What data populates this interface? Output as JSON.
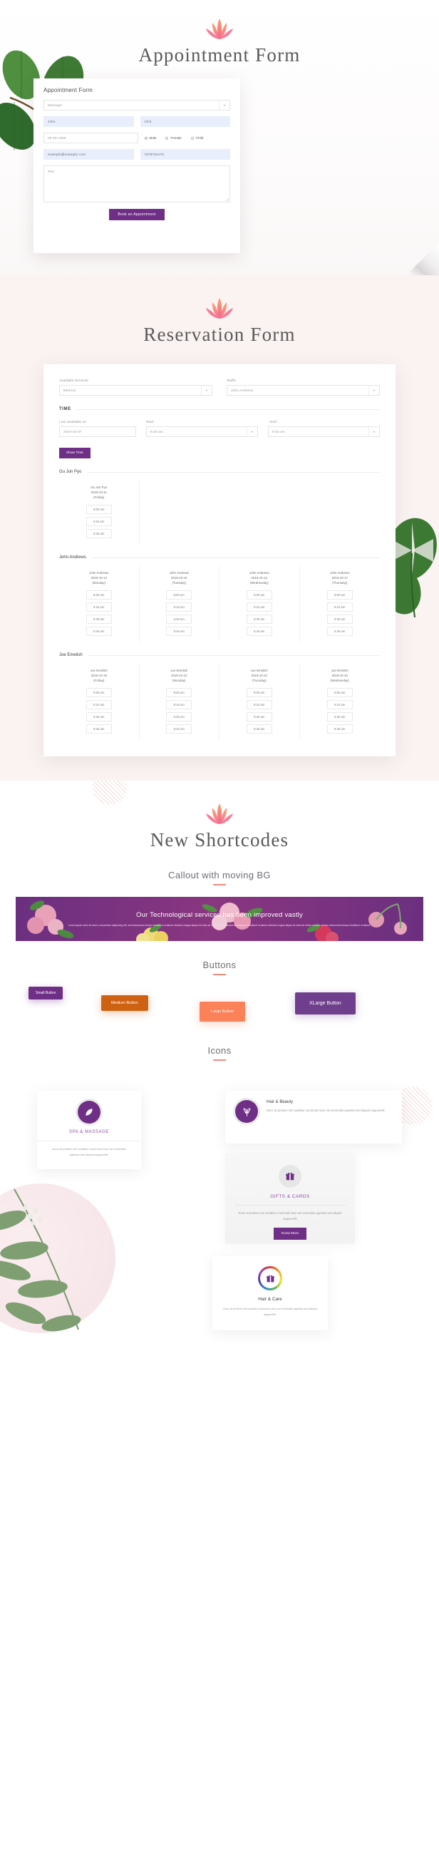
{
  "appointment": {
    "page_title": "Appointment Form",
    "card_title": "Appointment Form",
    "service_value": "Massage",
    "first_name": "John",
    "last_name": "Clint",
    "dob": "08-09-1996",
    "gender_options": [
      "Male",
      "Female",
      "Child"
    ],
    "gender_selected": "Male",
    "email": "example@example.com",
    "phone": "7878754175",
    "message": "Test",
    "submit_label": "Book an Appointment"
  },
  "reservation": {
    "page_title": "Reservation Form",
    "services_label": "Available Services",
    "services_value": "Medical",
    "staffs_label": "Staffs",
    "staffs_value": "John Andrews",
    "time_heading": "TIME",
    "available_label": "I am available on",
    "available_value": "2019-10-07",
    "start_label": "Start :",
    "start_value": "8:00 am",
    "dash": "-",
    "end_label": "End :",
    "end_value": "9:00 am",
    "show_time_label": "Show Time",
    "groups": [
      {
        "name": "Gu Jun Pyo",
        "columns": [
          {
            "staff": "Gu Jun Pyo",
            "date": "2019-10-11",
            "day": "(Friday)",
            "slots": [
              "8:00 am",
              "8:15 am",
              "8:45 am"
            ]
          }
        ]
      },
      {
        "name": "John Andrews",
        "columns": [
          {
            "staff": "John Andrews",
            "date": "2019-10-14",
            "day": "(Monday)",
            "slots": [
              "8:00 am",
              "8:15 am",
              "8:30 am",
              "8:45 am"
            ]
          },
          {
            "staff": "John Andrews",
            "date": "2019-10-15",
            "day": "(Tuesday)",
            "slots": [
              "8:00 am",
              "8:15 am",
              "8:30 am",
              "8:45 am"
            ]
          },
          {
            "staff": "John Andrews",
            "date": "2019-10-16",
            "day": "(Wednesday)",
            "slots": [
              "8:00 am",
              "8:15 am",
              "8:30 am",
              "8:45 am"
            ]
          },
          {
            "staff": "John Andrews",
            "date": "2019-10-17",
            "day": "(Thursday)",
            "slots": [
              "8:00 am",
              "8:15 am",
              "8:30 am",
              "8:45 am"
            ]
          }
        ]
      },
      {
        "name": "Joe Emelish",
        "columns": [
          {
            "staff": "Joe Emelish",
            "date": "2019-10-18",
            "day": "(Friday)",
            "slots": [
              "8:00 am",
              "8:15 am",
              "8:30 am",
              "8:45 am"
            ]
          },
          {
            "staff": "Joe Emelish",
            "date": "2019-10-21",
            "day": "(Monday)",
            "slots": [
              "8:00 am",
              "8:15 am",
              "8:30 am",
              "8:45 am"
            ]
          },
          {
            "staff": "Joe Emelish",
            "date": "2019-10-22",
            "day": "(Tuesday)",
            "slots": [
              "8:00 am",
              "8:15 am",
              "8:30 am",
              "8:45 am"
            ]
          },
          {
            "staff": "Joe Emelish",
            "date": "2019-10-23",
            "day": "(Wednesday)",
            "slots": [
              "8:00 am",
              "8:15 am",
              "8:30 am",
              "8:45 am"
            ]
          }
        ]
      }
    ]
  },
  "shortcodes": {
    "page_title": "New Shortcodes",
    "callout": {
      "heading": "Callout with moving BG",
      "title": "Our Technological services has been improved vastly",
      "body": "Lorem ipsum dolor sit amet, consectetur adipiscing elit, sed doeiusmod tempor incididunt ut labore etdolore magna aliqua Ut enim ad minim veniam doeiusmod tempor incididunt ut labore etdolore magna aliqua Ut enim ad minim veniam veniam doeiusmod tempor incididunt ut labore."
    },
    "buttons": {
      "heading": "Buttons",
      "items": [
        {
          "label": "Small Button",
          "color": "#6f2f86"
        },
        {
          "label": "Medium Button",
          "color": "#cf6113"
        },
        {
          "label": "Large Button",
          "color": "#fb8158"
        },
        {
          "label": "XLarge Button",
          "color": "#6f3e8c"
        }
      ]
    },
    "icons": {
      "heading": "Icons",
      "cards": [
        {
          "id": "spa",
          "title": "SPA & MASSAGE",
          "desc": "Nunc at pretium est curabitur commodo leac est venenatis egestas sed aliquet auguevelit.",
          "icon": "leaf-icon"
        },
        {
          "id": "hair-beauty",
          "title": "Hair & Beauty",
          "desc": "Nunc at pretium est curabitur commodo leac est venenatis egestas sed aliquet auguevelit.",
          "icon": "plant-icon"
        },
        {
          "id": "gifts-cards",
          "title": "GIFTS & CARDS",
          "desc": "Nunc at pretium est curabitur commodo leac est venenatis egestas sed aliquet auguevelit.",
          "icon": "gift-icon",
          "button_label": "Know More"
        },
        {
          "id": "hair-care",
          "title": "Hair & Care",
          "desc": "Nunc at pretium est curabitur commodo leac est venenatis egestas sed aliquet auguevelit.",
          "icon": "gift-icon"
        }
      ]
    }
  },
  "theme": {
    "purple": "#6f2f86",
    "orange": "#cf6113",
    "coral": "#fb8158",
    "accent_line": "#f08a7d",
    "beige_bg": "#faf3f1"
  }
}
